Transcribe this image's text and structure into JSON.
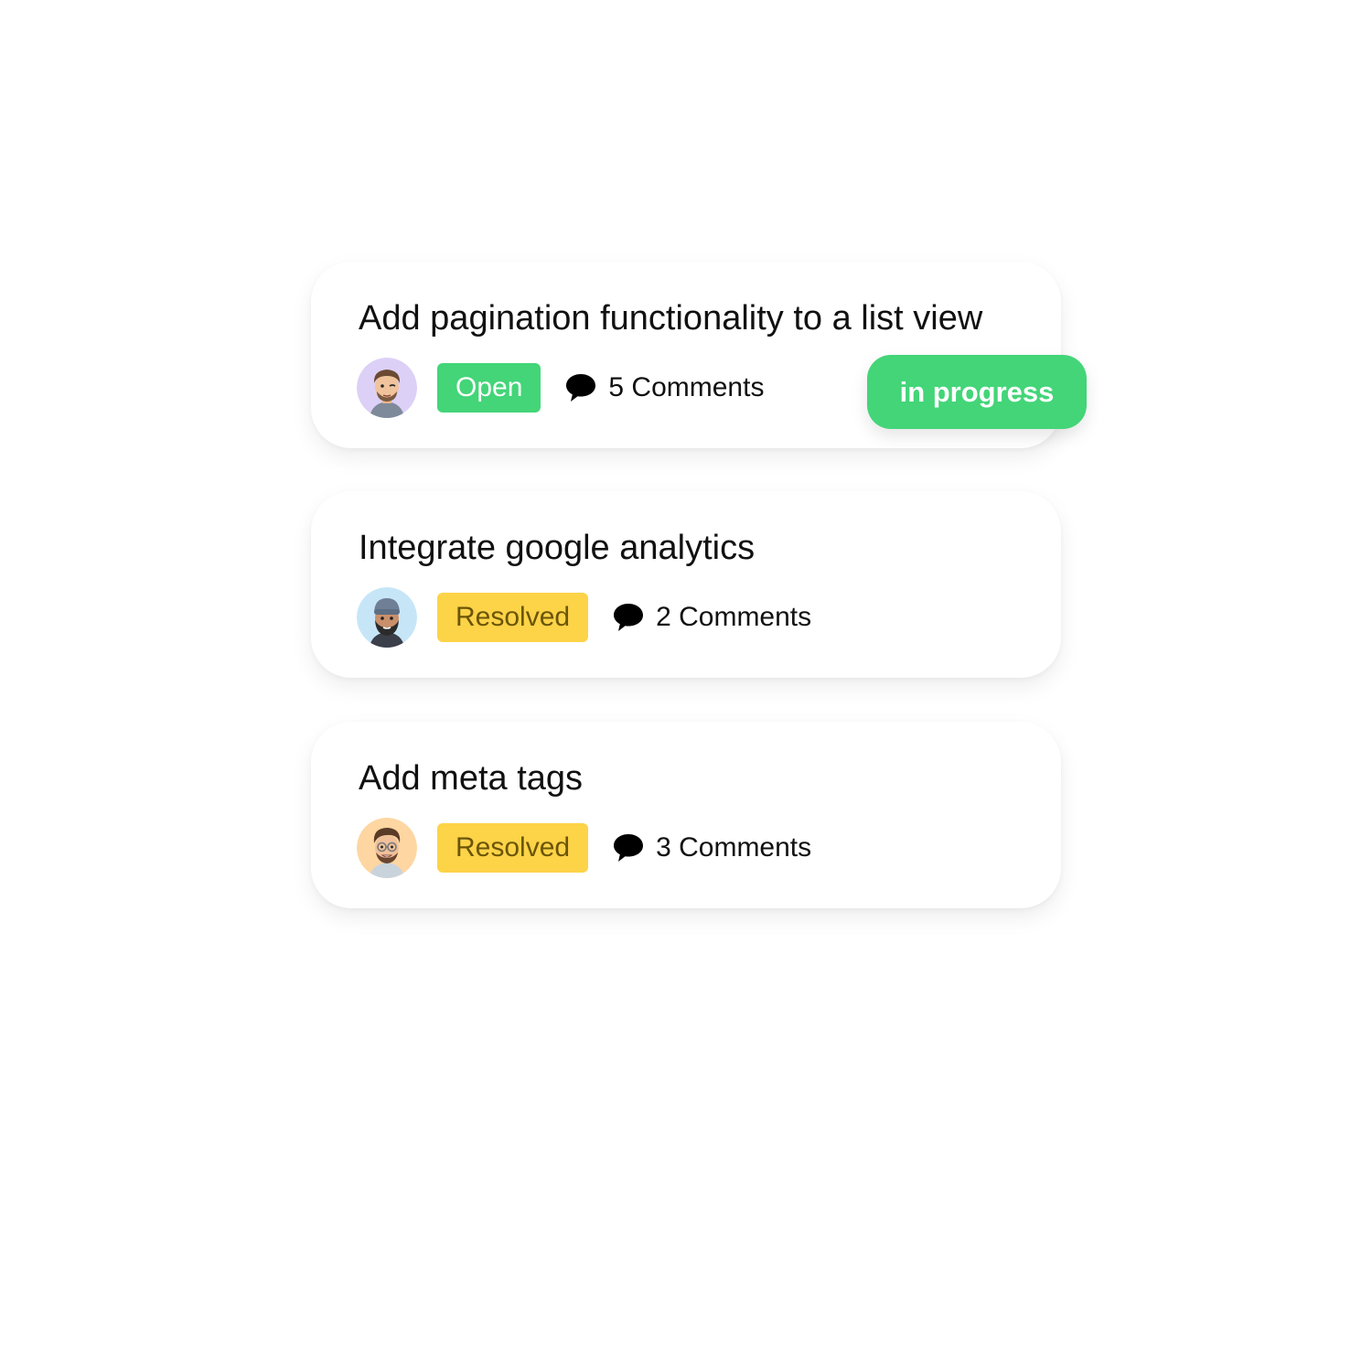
{
  "colors": {
    "open_badge": "#43d578",
    "resolved_badge": "#fdd348",
    "resolved_text": "#6b5506",
    "in_progress_pill": "#43d578",
    "card_background": "#ffffff"
  },
  "tasks": [
    {
      "title": "Add pagination functionality to a list view",
      "status": "Open",
      "comments": "5 Comments",
      "avatar_icon": "winking-man-avatar",
      "avatar_bg": "#ddd0f7"
    },
    {
      "title": "Integrate google analytics",
      "status": "Resolved",
      "comments": "2 Comments",
      "avatar_icon": "bearded-man-beanie-avatar",
      "avatar_bg": "#c6e6f8"
    },
    {
      "title": "Add meta tags",
      "status": "Resolved",
      "comments": "3 Comments",
      "avatar_icon": "man-with-glasses-avatar",
      "avatar_bg": "#fdd6a2"
    }
  ],
  "drag_pill": {
    "label": "in progress"
  }
}
